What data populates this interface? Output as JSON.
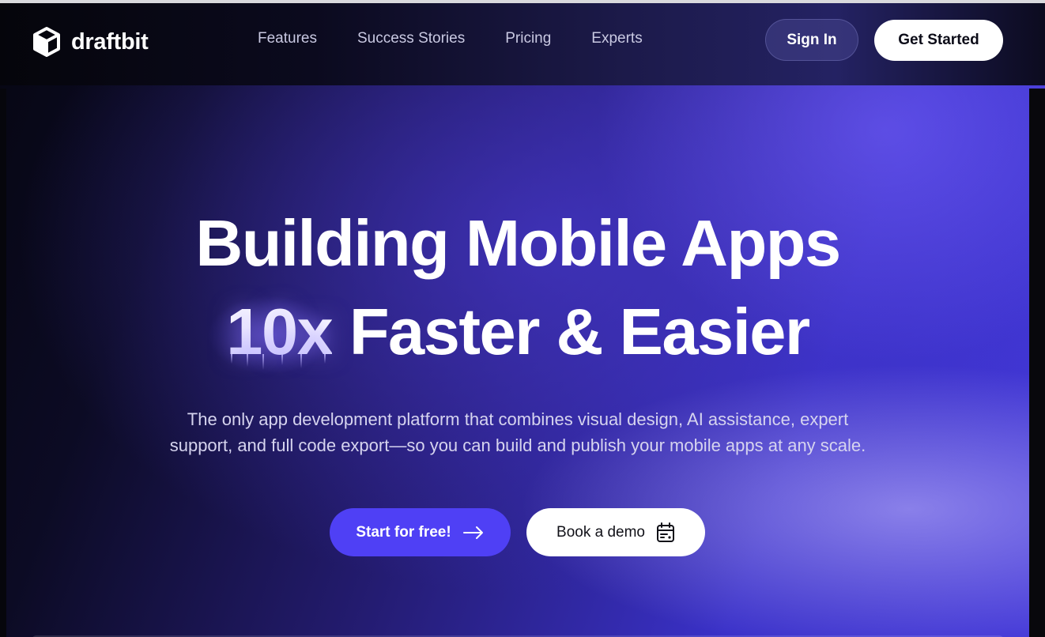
{
  "brand": {
    "name": "draftbit",
    "logo_icon": "cube-icon"
  },
  "nav": {
    "links": [
      "Features",
      "Success Stories",
      "Pricing",
      "Experts"
    ],
    "sign_in": "Sign In",
    "get_started": "Get Started"
  },
  "hero": {
    "title_line1": "Building Mobile Apps",
    "title_accent": "10x",
    "title_line2_rest": "Faster & Easier",
    "subtitle": "The only app development platform that combines visual design, AI assistance, expert support, and full code export—so you can build and publish your mobile apps at any scale.",
    "cta_primary": "Start for free!",
    "cta_primary_icon": "arrow-right-icon",
    "cta_secondary": "Book a demo",
    "cta_secondary_icon": "calendar-icon"
  },
  "colors": {
    "primary_button": "#4f40f5",
    "background_dark": "#0a0a14",
    "background_purple": "#4338d8"
  }
}
